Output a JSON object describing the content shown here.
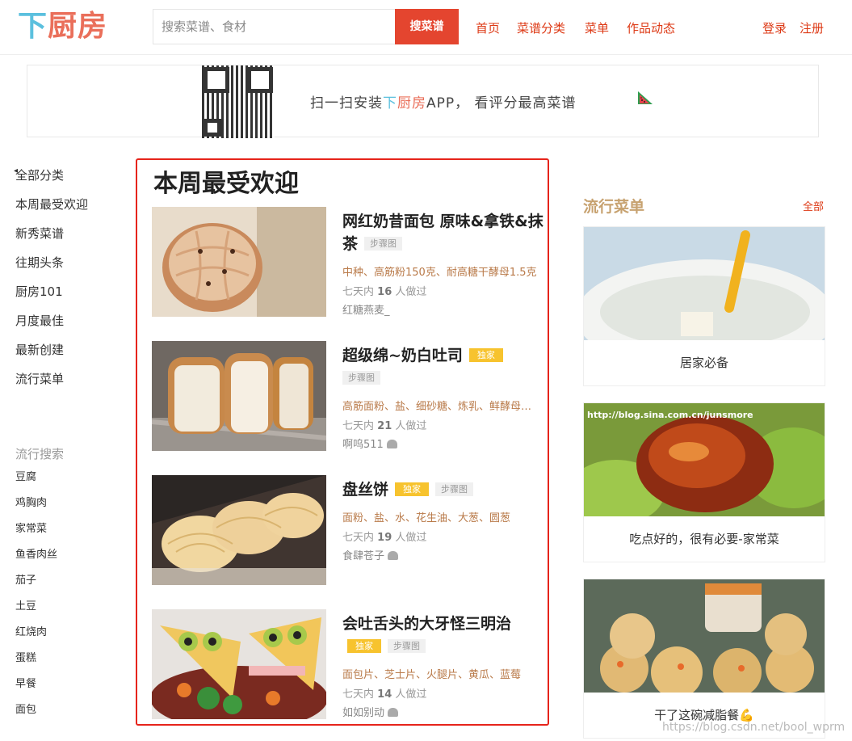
{
  "header": {
    "logo": [
      "下",
      "厨",
      "房"
    ],
    "search_placeholder": "搜索菜谱、食材",
    "search_button": "搜菜谱",
    "nav": [
      "首页",
      "菜谱分类",
      "菜单",
      "作品动态"
    ],
    "login": "登录",
    "register": "注册"
  },
  "banner": {
    "text_pre": "扫一扫安装",
    "text_brand_1": "下",
    "text_brand_2": "厨房",
    "text_post": "APP， 看评分最高菜谱",
    "icon": "watermelon-icon"
  },
  "sidebar": {
    "items": [
      "全部分类",
      "本周最受欢迎",
      "新秀菜谱",
      "往期头条",
      "厨房101",
      "月度最佳",
      "最新创建",
      "流行菜单"
    ],
    "hot_title": "流行搜索",
    "hot_items": [
      "豆腐",
      "鸡胸肉",
      "家常菜",
      "鱼香肉丝",
      "茄子",
      "土豆",
      "红烧肉",
      "蛋糕",
      "早餐",
      "面包"
    ]
  },
  "main": {
    "title": "本周最受欢迎",
    "recipes": [
      {
        "title": "网红奶昔面包 原味&拿铁&抹茶",
        "exclusive": "",
        "step": "步骤图",
        "ingredients": "中种、高筋粉150克、耐高糖干酵母1.5克",
        "stat_pre": "七天内",
        "count": "16",
        "stat_post": "人做过",
        "author": "红糖燕麦_"
      },
      {
        "title": "超级绵~奶白吐司",
        "exclusive": "独家",
        "step": "步骤图",
        "ingredients": "高筋面粉、盐、细砂糖、炼乳、鲜酵母、奶粉",
        "stat_pre": "七天内",
        "count": "21",
        "stat_post": "人做过",
        "author": "啊呜511"
      },
      {
        "title": "盘丝饼",
        "exclusive": "独家",
        "step": "步骤图",
        "ingredients": "面粉、盐、水、花生油、大葱、圆葱",
        "stat_pre": "七天内",
        "count": "19",
        "stat_post": "人做过",
        "author": "食肆苍子"
      },
      {
        "title": "会吐舌头的大牙怪三明治",
        "exclusive": "独家",
        "step": "步骤图",
        "ingredients": "面包片、芝士片、火腿片、黄瓜、蓝莓",
        "stat_pre": "七天内",
        "count": "14",
        "stat_post": "人做过",
        "author": "如如别动"
      }
    ]
  },
  "right": {
    "title": "流行菜单",
    "all": "全部",
    "menus": [
      {
        "label": "居家必备"
      },
      {
        "label": "吃点好的，很有必要-家常菜",
        "img_text": "http://blog.sina.com.cn/junsmore"
      },
      {
        "label": "干了这碗减脂餐💪"
      }
    ]
  },
  "watermark": "https://blog.csdn.net/bool_wprm"
}
